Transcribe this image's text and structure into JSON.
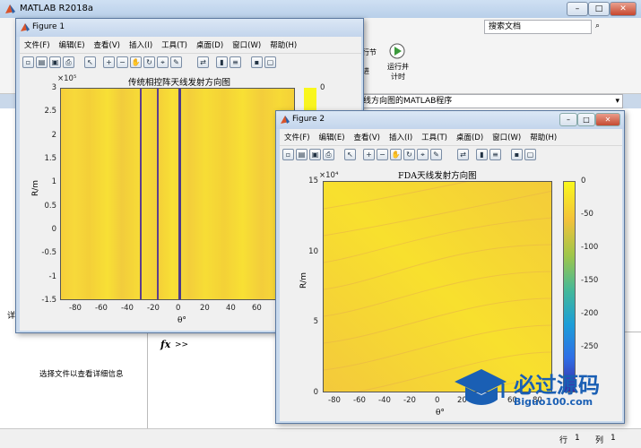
{
  "app": {
    "title": "MATLAB R2018a",
    "search_placeholder": "搜索文档",
    "toolstrip": {
      "run_section": "行节",
      "advance": "进",
      "run_time": "运行并\n计时"
    },
    "path_text": "线方向图的MATLAB程序",
    "detail_text": "选择文件以查看详细信息",
    "cmd_prompt": ">>",
    "fx": "fx",
    "detail_header": "详",
    "status": {
      "row_label": "行",
      "row": "1",
      "col_label": "列",
      "col": "1"
    }
  },
  "menu": [
    "文件(F)",
    "编辑(E)",
    "查看(V)",
    "插入(I)",
    "工具(T)",
    "桌面(D)",
    "窗口(W)",
    "帮助(H)"
  ],
  "figure1": {
    "title": "Figure 1",
    "plot_title": "传统相控阵天线发射方向图",
    "ylabel": "R/m",
    "xlabel": "θ°",
    "exponent": "×10⁵",
    "xticks": [
      "-80",
      "-60",
      "-40",
      "-20",
      "0",
      "20",
      "40",
      "60"
    ],
    "yticks": [
      "3",
      "2.5",
      "2",
      "1.5",
      "1",
      "0.5",
      "0",
      "-0.5",
      "-1",
      "-1.5"
    ],
    "colorbar_tick": "0"
  },
  "figure2": {
    "title": "Figure 2",
    "plot_title": "FDA天线发射方向图",
    "ylabel": "R/m",
    "xlabel": "θ°",
    "exponent": "×10⁴",
    "xticks": [
      "-80",
      "-60",
      "-40",
      "-20",
      "0",
      "20",
      "40",
      "60",
      "80"
    ],
    "yticks": [
      "15",
      "10",
      "5",
      "0"
    ],
    "colorbar_ticks": [
      "0",
      "-50",
      "-100",
      "-150",
      "-200",
      "-250"
    ]
  },
  "watermark": {
    "text": "必过源码",
    "url": "Biguo100.com"
  },
  "colors": {
    "field_yellow": "#f5d631",
    "null_line": "#6a4a9a",
    "colorbar_top": "#f9f81c",
    "colorbar_bottom": "#3a2a9e"
  }
}
